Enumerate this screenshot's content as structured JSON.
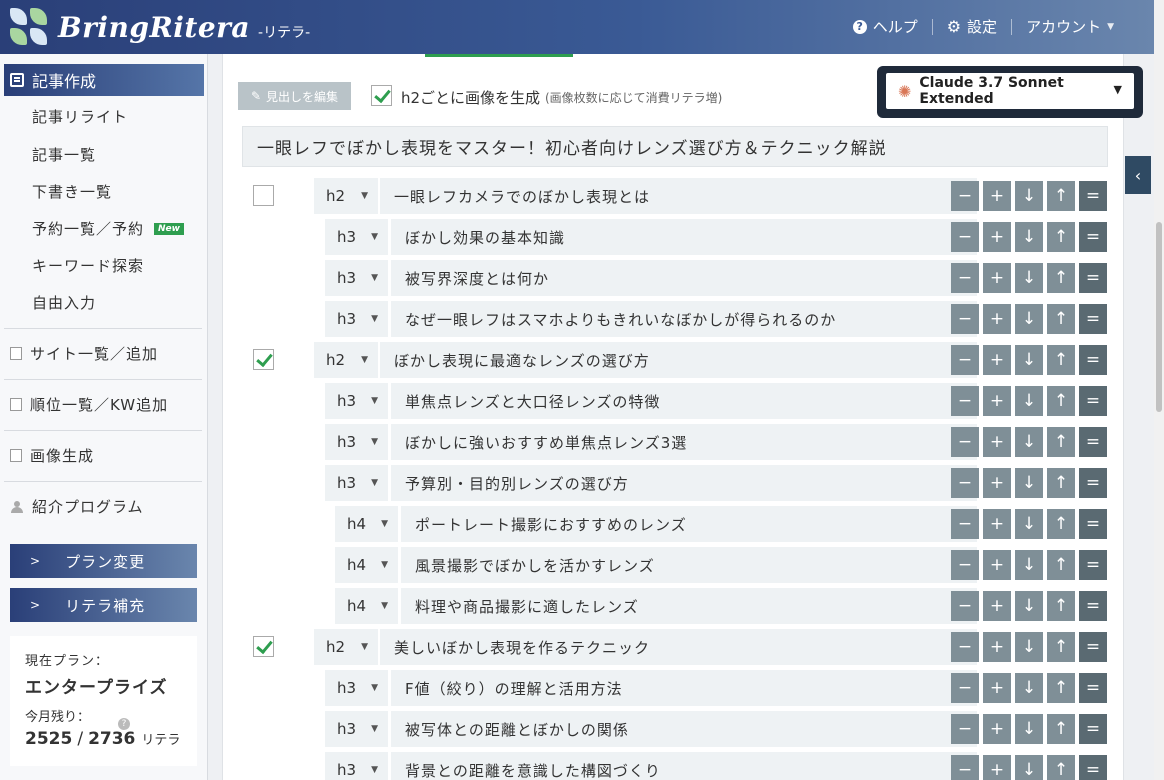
{
  "header": {
    "brand": "BringRitera",
    "brand_sub": "-リテラ-",
    "help": "ヘルプ",
    "settings": "設定",
    "account": "アカウント"
  },
  "sidebar": {
    "active": "記事作成",
    "sub_items": [
      "記事リライト",
      "記事一覧",
      "下書き一覧",
      "予約一覧／予約",
      "キーワード探索",
      "自由入力"
    ],
    "new_badge": "New",
    "main_items": [
      "サイト一覧／追加",
      "順位一覧／KW追加",
      "画像生成",
      "紹介プログラム"
    ],
    "plan_change": "プラン変更",
    "credit_topup": "リテラ補充",
    "plan_label": "現在プラン：",
    "plan_name": "エンタープライズ",
    "remain_label": "今月残り：",
    "remain": "2525",
    "total": "2736",
    "unit": "リテラ"
  },
  "toolbar": {
    "edit_headings": "見出しを編集",
    "gen_label": "h2ごとに画像を生成",
    "gen_note": "(画像枚数に応じて消費リテラ増)",
    "gen_checked": true,
    "model": "Claude 3.7 Sonnet Extended"
  },
  "article_title": "一眼レフでぼかし表現をマスター！初心者向けレンズ選び方＆テクニック解説",
  "controls": [
    "−",
    "+",
    "↓",
    "↑",
    "="
  ],
  "headings": [
    {
      "level": "h2",
      "text": "一眼レフカメラでのぼかし表現とは",
      "checked": false
    },
    {
      "level": "h3",
      "text": "ぼかし効果の基本知識"
    },
    {
      "level": "h3",
      "text": "被写界深度とは何か"
    },
    {
      "level": "h3",
      "text": "なぜ一眼レフはスマホよりもきれいなぼかしが得られるのか"
    },
    {
      "level": "h2",
      "text": "ぼかし表現に最適なレンズの選び方",
      "checked": true
    },
    {
      "level": "h3",
      "text": "単焦点レンズと大口径レンズの特徴"
    },
    {
      "level": "h3",
      "text": "ぼかしに強いおすすめ単焦点レンズ3選"
    },
    {
      "level": "h3",
      "text": "予算別・目的別レンズの選び方"
    },
    {
      "level": "h4",
      "text": "ポートレート撮影におすすめのレンズ"
    },
    {
      "level": "h4",
      "text": "風景撮影でぼかしを活かすレンズ"
    },
    {
      "level": "h4",
      "text": "料理や商品撮影に適したレンズ"
    },
    {
      "level": "h2",
      "text": "美しいぼかし表現を作るテクニック",
      "checked": true
    },
    {
      "level": "h3",
      "text": "F値（絞り）の理解と活用方法"
    },
    {
      "level": "h3",
      "text": "被写体との距離とぼかしの関係"
    },
    {
      "level": "h3",
      "text": "背景との距離を意識した構図づくり"
    }
  ],
  "colors": {
    "accent": "#2e9e4f",
    "brand": "#2a3f78",
    "control": "#7f8f97"
  }
}
